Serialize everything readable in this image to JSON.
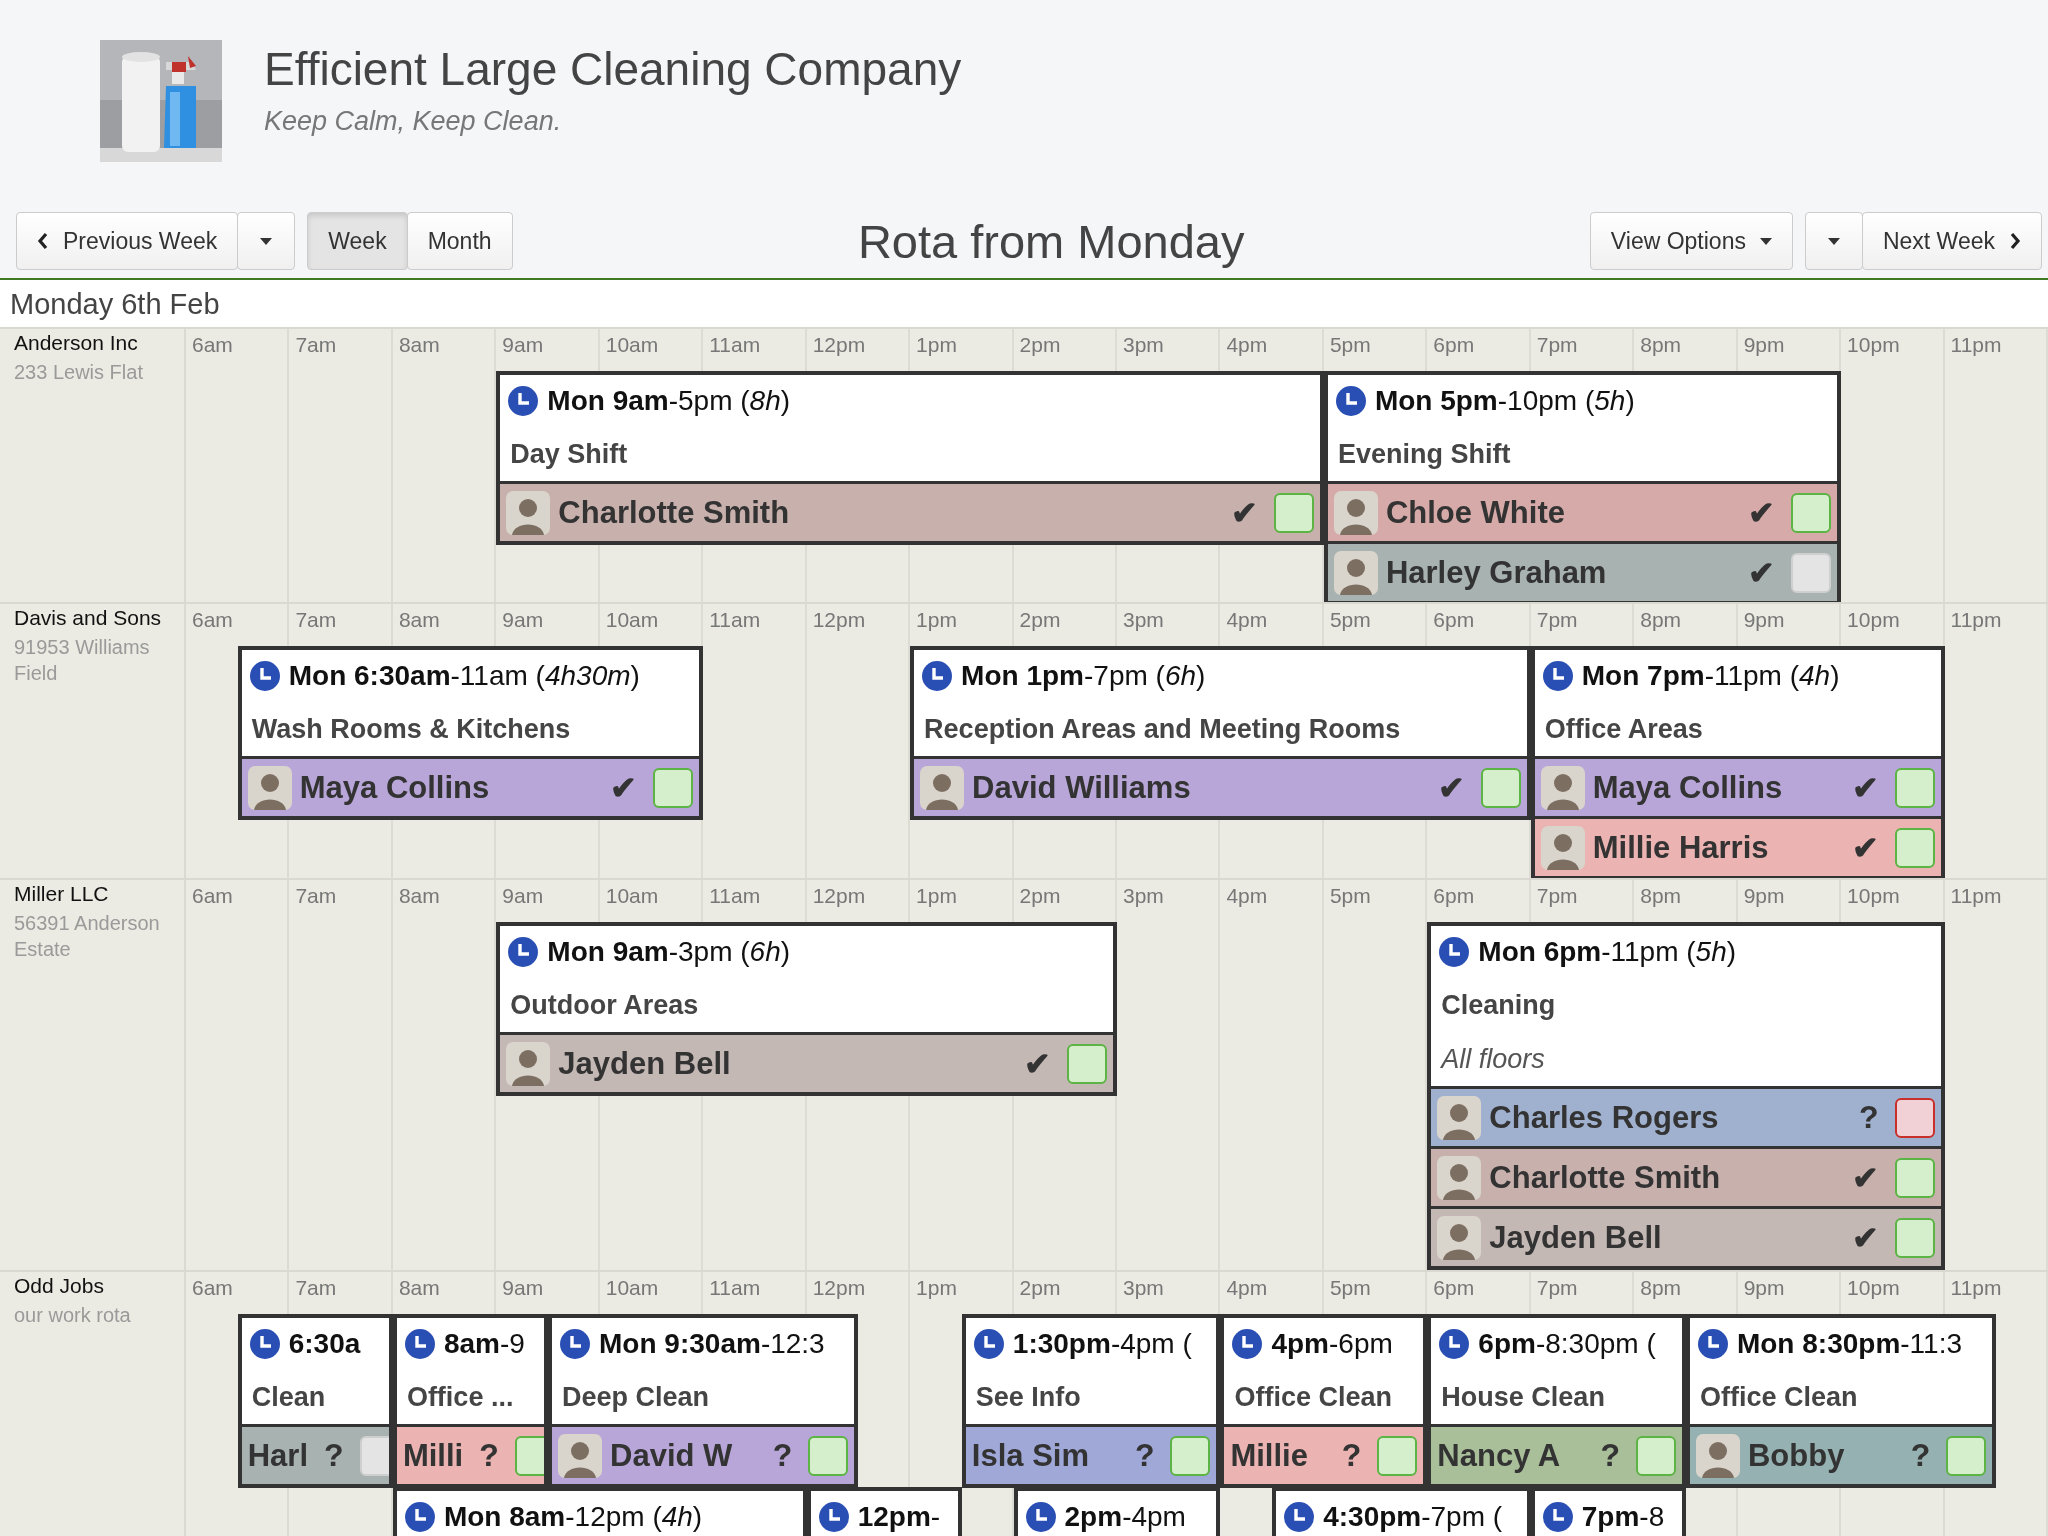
{
  "header": {
    "title": "Efficient Large Cleaning Company",
    "tagline": "Keep Calm, Keep Clean."
  },
  "toolbar": {
    "previous": "Previous Week",
    "views": [
      {
        "label": "Week",
        "selected": true
      },
      {
        "label": "Month",
        "selected": false
      }
    ],
    "heading": "Rota from Monday",
    "view_options": "View Options",
    "next": "Next Week"
  },
  "day": "Monday 6th Feb",
  "sites": [
    {
      "name": "Anderson Inc",
      "address": "233 Lewis Flat",
      "hours": [
        "6am",
        "7am",
        "8am",
        "9am",
        "10am",
        "11am",
        "12pm",
        "1pm",
        "2pm",
        "3pm",
        "4pm",
        "5pm",
        "6pm",
        "7pm",
        "8pm",
        "9pm",
        "10pm",
        "11pm"
      ],
      "shifts": [
        {
          "time": "**Mon 9am**-5pm (*8h*)",
          "title": "Day Shift",
          "staff": [
            {
              "name": "Charlotte Smith",
              "avatar": true,
              "mark": "✔",
              "confirmed": true,
              "declined": false,
              "color": "#c8b0ad"
            }
          ]
        },
        {
          "time": "**Mon 5pm**-10pm (*5h*)",
          "title": "Evening Shift",
          "staff": [
            {
              "name": "Chloe White",
              "avatar": true,
              "mark": "✔",
              "confirmed": true,
              "declined": false,
              "color": "#d6aaa8"
            },
            {
              "name": "Harley Graham",
              "avatar": true,
              "mark": "✔",
              "confirmed": false,
              "declined": false,
              "color": "#a8b2b1"
            }
          ]
        }
      ]
    },
    {
      "name": "Davis and Sons",
      "address": "91953 Williams Field",
      "hours": [
        "6am",
        "7am",
        "8am",
        "9am",
        "10am",
        "11am",
        "12pm",
        "1pm",
        "2pm",
        "3pm",
        "4pm",
        "5pm",
        "6pm",
        "7pm",
        "8pm",
        "9pm",
        "10pm",
        "11pm"
      ],
      "shifts": [
        {
          "time": "**Mon 6:30am**-11am (*4h30m*)",
          "title": "Wash Rooms & Kitchens",
          "staff": [
            {
              "name": "Maya Collins",
              "avatar": true,
              "mark": "✔",
              "confirmed": true,
              "declined": false,
              "color": "#b8a6d8"
            }
          ]
        },
        {
          "time": "**Mon 1pm**-7pm (*6h*)",
          "title": "Reception Areas and Meeting Rooms",
          "staff": [
            {
              "name": "David Williams",
              "avatar": true,
              "mark": "✔",
              "confirmed": true,
              "declined": false,
              "color": "#b8a6d8"
            }
          ]
        },
        {
          "time": "**Mon 7pm**-11pm (*4h*)",
          "title": "Office Areas",
          "staff": [
            {
              "name": "Maya Collins",
              "avatar": true,
              "mark": "✔",
              "confirmed": true,
              "declined": false,
              "color": "#b8a6d8"
            },
            {
              "name": "Millie Harris",
              "avatar": true,
              "mark": "✔",
              "confirmed": true,
              "declined": false,
              "color": "#ebb3b1"
            }
          ]
        }
      ]
    },
    {
      "name": "Miller LLC",
      "address": "56391 Anderson Estate",
      "hours": [
        "6am",
        "7am",
        "8am",
        "9am",
        "10am",
        "11am",
        "12pm",
        "1pm",
        "2pm",
        "3pm",
        "4pm",
        "5pm",
        "6pm",
        "7pm",
        "8pm",
        "9pm",
        "10pm",
        "11pm"
      ],
      "shifts": [
        {
          "time": "**Mon 9am**-3pm (*6h*)",
          "title": "Outdoor Areas",
          "staff": [
            {
              "name": "Jayden Bell",
              "avatar": true,
              "mark": "✔",
              "confirmed": true,
              "declined": false,
              "color": "#c4b8b5"
            }
          ]
        },
        {
          "time": "**Mon 6pm**-11pm (*5h*)",
          "title": "Cleaning",
          "note": "All floors",
          "staff": [
            {
              "name": "Charles Rogers",
              "avatar": true,
              "mark": "?",
              "confirmed": false,
              "declined": true,
              "color": "#a0b1d0"
            },
            {
              "name": "Charlotte Smith",
              "avatar": true,
              "mark": "✔",
              "confirmed": true,
              "declined": false,
              "color": "#c8b0ad"
            },
            {
              "name": "Jayden Bell",
              "avatar": true,
              "mark": "✔",
              "confirmed": true,
              "declined": false,
              "color": "#c4b8b5"
            }
          ]
        }
      ]
    },
    {
      "name": "Odd Jobs",
      "address": "our work rota",
      "hours": [
        "6am",
        "7am",
        "8am",
        "9am",
        "10am",
        "11am",
        "12pm",
        "1pm",
        "2pm",
        "3pm",
        "4pm",
        "5pm",
        "6pm",
        "7pm",
        "8pm",
        "9pm",
        "10pm",
        "11pm"
      ],
      "shifts": [
        {
          "time": "**6:30a**",
          "title": "Clean",
          "staff": [
            {
              "name": "Harl",
              "avatar": false,
              "mark": "?",
              "confirmed": false,
              "declined": false,
              "color": "#a8b2b1"
            }
          ]
        },
        {
          "time": "**8am**-9",
          "title": "Office ...",
          "staff": [
            {
              "name": "Milli",
              "avatar": false,
              "mark": "?",
              "confirmed": true,
              "declined": false,
              "color": "#ebb3b1"
            }
          ]
        },
        {
          "time": "**Mon 9:30am**-12:3",
          "title": "Deep Clean",
          "staff": [
            {
              "name": "David W",
              "avatar": true,
              "mark": "?",
              "confirmed": true,
              "declined": false,
              "color": "#b8a6d8"
            }
          ]
        },
        {
          "time": "**1:30pm**-4pm (",
          "title": "See Info",
          "staff": [
            {
              "name": "Isla Sim",
              "avatar": false,
              "mark": "?",
              "confirmed": true,
              "declined": false,
              "color": "#a0a8d8"
            }
          ]
        },
        {
          "time": "**4pm**-6pm",
          "title": "Office Clean",
          "staff": [
            {
              "name": "Millie",
              "avatar": false,
              "mark": "?",
              "confirmed": true,
              "declined": false,
              "color": "#ebb3b1"
            }
          ]
        },
        {
          "time": "**6pm**-8:30pm (",
          "title": "House Clean",
          "staff": [
            {
              "name": "Nancy A",
              "avatar": false,
              "mark": "?",
              "confirmed": true,
              "declined": false,
              "color": "#a9bf9a"
            }
          ]
        },
        {
          "time": "**Mon 8:30pm**-11:3",
          "title": "Office Clean",
          "staff": [
            {
              "name": "Bobby",
              "avatar": true,
              "mark": "?",
              "confirmed": true,
              "declined": false,
              "color": "#96b1b1"
            }
          ]
        },
        {
          "time": "**Mon 8am**-12pm (*4h*)"
        },
        {
          "time": "**12pm**-"
        },
        {
          "time": "**2pm**-4pm"
        },
        {
          "time": "**4:30pm**-7pm ("
        },
        {
          "time": "**7pm**-8"
        }
      ]
    }
  ]
}
